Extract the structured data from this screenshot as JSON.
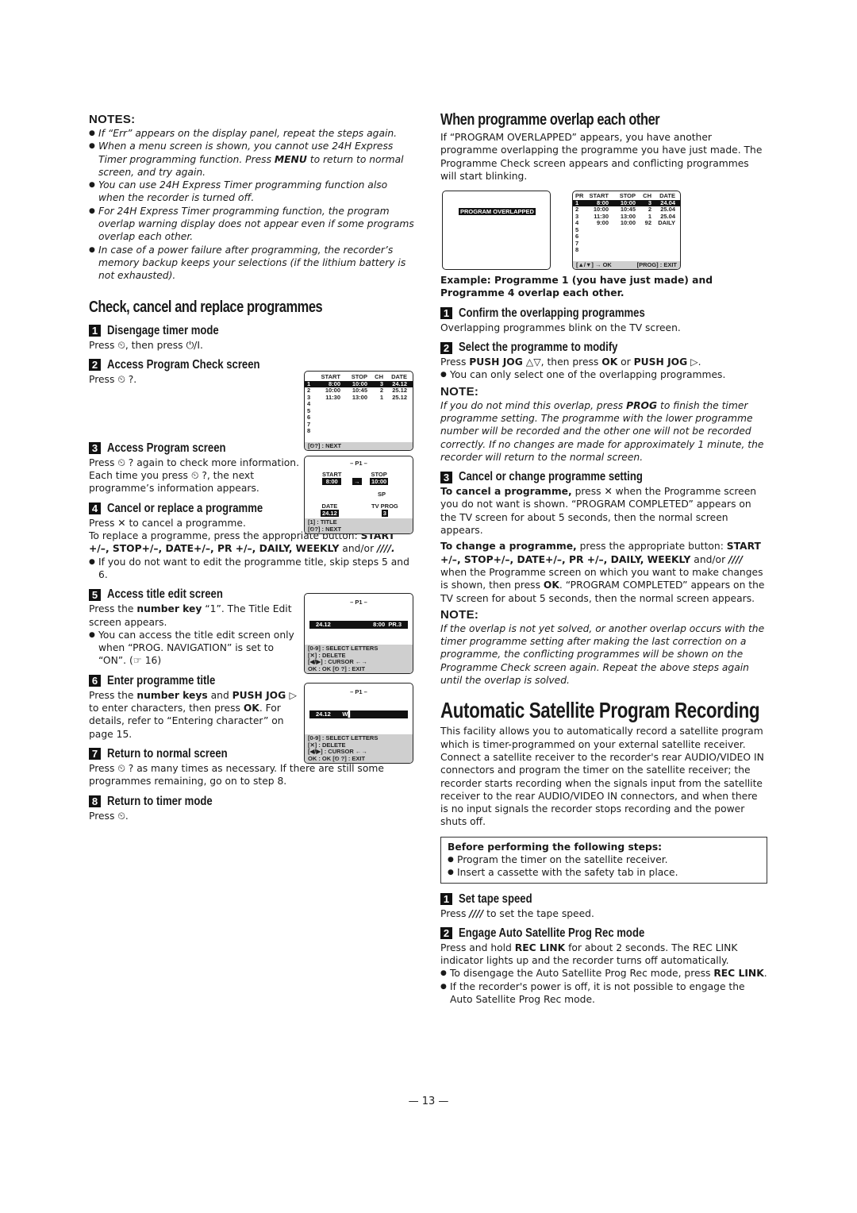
{
  "left": {
    "notes_title": "NOTES:",
    "notes": [
      "If “Err” appears on the display panel, repeat the steps again.",
      "When a menu screen is shown, you cannot use 24H Express Timer programming function. Press MENU to return to normal screen, and try again.",
      "You can use 24H Express Timer programming function also when the recorder is turned off.",
      "For 24H Express Timer programming function, the program overlap warning display does not appear even if some programs overlap each other.",
      "In case of a power failure after programming, the recorder’s memory backup keeps your selections (if the lithium battery is not exhausted)."
    ],
    "note2_pre": "When a menu screen is shown, you cannot use 24H Express Timer programming function. Press ",
    "note2_bold": "MENU",
    "note2_post": " to return to normal screen, and try again.",
    "section_title": "Check, cancel and replace programmes",
    "steps": [
      {
        "num": "1",
        "title": "Disengage timer mode",
        "text": "Press ⏲, then press ⏻/I."
      },
      {
        "num": "2",
        "title": "Access Program Check screen",
        "text": "Press ⏲ ?."
      },
      {
        "num": "3",
        "title": "Access Program screen",
        "text": "Press ⏲ ? again to check more information. Each time you press ⏲ ?, the next programme’s information appears."
      },
      {
        "num": "4",
        "title": "Cancel or replace a programme",
        "text1": "Press ✕ to cancel a programme.",
        "text2_pre": "To replace a programme, press the appropriate button: ",
        "text2_bold": "START +/–, STOP+/–, DATE+/–, PR +/–, DAILY, WEEKLY",
        "text2_mid": " and/or ",
        "text2_end": "////.",
        "bullet": "If you do not want to edit the programme title, skip steps 5 and 6."
      },
      {
        "num": "5",
        "title": "Access title edit screen",
        "text_pre": "Press the ",
        "text_bold": "number key",
        "text_post": " “1”. The Title Edit screen appears.",
        "bullet": "You can access the title edit screen only when “PROG. NAVIGATION” is set to “ON”. (☞ 16)"
      },
      {
        "num": "6",
        "title": "Enter programme title",
        "text_pre": "Press the ",
        "text_bold1": "number keys",
        "text_mid": " and ",
        "text_bold2": "PUSH JOG ▷",
        "text_post": " to enter characters, then press ",
        "text_bold3": "OK",
        "text_end": ". For details, refer to “Entering character” on page 15."
      },
      {
        "num": "7",
        "title": "Return to normal screen",
        "text": "Press ⏲ ? as many times as necessary. If there are still some programmes remaining, go on to step 8."
      },
      {
        "num": "8",
        "title": "Return to timer mode",
        "text": "Press ⏲."
      }
    ],
    "check_screen": {
      "headers": [
        "",
        "START",
        "STOP",
        "CH",
        "DATE"
      ],
      "rows": [
        [
          "1",
          "8:00",
          "10:00",
          "3",
          "24.12"
        ],
        [
          "2",
          "10:00",
          "10:45",
          "2",
          "25.12"
        ],
        [
          "3",
          "11:30",
          "13:00",
          "1",
          "25.12"
        ],
        [
          "4",
          "",
          "",
          "",
          ""
        ],
        [
          "5",
          "",
          "",
          "",
          ""
        ],
        [
          "6",
          "",
          "",
          "",
          ""
        ],
        [
          "7",
          "",
          "",
          "",
          ""
        ],
        [
          "8",
          "",
          "",
          "",
          ""
        ]
      ],
      "footer": "[⏲?] : NEXT"
    },
    "program_screen": {
      "title": "– P1 –",
      "start_label": "START",
      "start_value": "8:00",
      "stop_label": "STOP",
      "stop_value": "10:00",
      "arrow": "→",
      "speed": "SP",
      "date_label": "DATE",
      "date_value": "24.12",
      "tvprog_label": "TV PROG",
      "tvprog_value": "3",
      "footer1": "[1] : TITLE",
      "footer2": "[⏲?] : NEXT"
    },
    "title_edit_screen": {
      "title": "– P1 –",
      "date": "24.12",
      "time": "8:00",
      "pr": "PR.3",
      "footer": [
        "[0-9] : SELECT LETTERS",
        "[✕] : DELETE",
        "[◀/▶] : CURSOR ←→",
        "OK : OK        [⏲ ?] : EXIT"
      ]
    },
    "title_enter_screen": {
      "title": "– P1 –",
      "date": "24.12",
      "chars": "W▌",
      "footer": [
        "[0-9] : SELECT LETTERS",
        "[✕] : DELETE",
        "[◀/▶] : CURSOR ←→",
        "OK : OK        [⏲ ?] : EXIT"
      ]
    }
  },
  "right": {
    "overlap_title": "When programme overlap each other",
    "overlap_intro": "If “PROGRAM OVERLAPPED” appears, you have another programme overlapping the programme you have just made. The Programme Check screen appears and conflicting programmes will start blinking.",
    "overlap_screen_label": "PROGRAM OVERLAPPED",
    "overlap_check_screen": {
      "headers": [
        "PR",
        "START",
        "STOP",
        "CH",
        "DATE"
      ],
      "rows": [
        [
          "1",
          "8:00",
          "10:00",
          "3",
          "24.04"
        ],
        [
          "2",
          "10:00",
          "10:45",
          "2",
          "25.04"
        ],
        [
          "3",
          "11:30",
          "13:00",
          "1",
          "25.04"
        ],
        [
          "4",
          "9:00",
          "10:00",
          "92",
          "DAILY"
        ],
        [
          "5",
          "",
          "",
          "",
          ""
        ],
        [
          "6",
          "",
          "",
          "",
          ""
        ],
        [
          "7",
          "",
          "",
          "",
          ""
        ],
        [
          "8",
          "",
          "",
          "",
          ""
        ]
      ],
      "footer_left": "[▲/▼] → OK",
      "footer_right": "[PROG] : EXIT"
    },
    "example": "Example: Programme 1 (you have just made) and Programme 4 overlap each other.",
    "steps": [
      {
        "num": "1",
        "title": "Confirm the overlapping programmes",
        "text": "Overlapping programmes blink on the TV screen."
      },
      {
        "num": "2",
        "title": "Select the programme to modify",
        "text_pre": "Press ",
        "b1": "PUSH JOG",
        "t1": " △▽, then press ",
        "b2": "OK",
        "t2": " or ",
        "b3": "PUSH JOG",
        "t3": " ▷.",
        "bullet": "You can only select one of the overlapping programmes."
      },
      {
        "num": "3",
        "title": "Cancel or change programme setting"
      }
    ],
    "note1_title": "NOTE:",
    "note1_pre": "If you do not mind this overlap, press ",
    "note1_bold": "PROG",
    "note1_post": " to finish the timer programme setting. The programme with the lower programme number will be recorded and the other one will not be recorded correctly. If no changes are made for approximately 1 minute, the recorder will return to the normal screen.",
    "cancel_bold": "To cancel a programme,",
    "cancel_text": " press ✕ when the Programme screen you do not want is shown. “PROGRAM COMPLETED” appears on the TV screen for about 5 seconds, then the normal screen appears.",
    "change_bold": "To change a programme,",
    "change_text1": " press the appropriate button: ",
    "change_buttons": "START +/–, STOP+/–, DATE+/–, PR +/–, DAILY, WEEKLY",
    "change_text2": " and/or ",
    "change_speed": "////",
    "change_text3": " when the Programme screen on which you want to make changes is shown, then press ",
    "change_ok": "OK",
    "change_text4": ". “PROGRAM COMPLETED” appears on the TV screen for about 5 seconds, then the normal screen appears.",
    "note2_title": "NOTE:",
    "note2_text": "If the overlap is not yet solved, or another overlap occurs with the timer programme setting after making the last correction on a programme, the conflicting programmes will be shown on the Programme Check screen again. Repeat the above steps again until the overlap is solved.",
    "sat_title": "Automatic Satellite Program Recording",
    "sat_intro": "This facility allows you to automatically record a satellite program which is timer-programmed on your external satellite receiver. Connect a satellite receiver to the recorder's rear AUDIO/VIDEO IN connectors and program the timer on the satellite receiver; the recorder starts recording when the signals input from the satellite receiver to the rear AUDIO/VIDEO IN connectors, and when there is no input signals the recorder stops recording and the power shuts off.",
    "before_title": "Before performing the following steps:",
    "before_items": [
      "Program the timer on the satellite receiver.",
      "Insert a cassette with the safety tab in place."
    ],
    "sat_steps": [
      {
        "num": "1",
        "title": "Set tape speed",
        "text_pre": "Press ",
        "text_bold": "////",
        "text_post": " to set the tape speed."
      },
      {
        "num": "2",
        "title": "Engage Auto Satellite Prog Rec mode",
        "text_pre": "Press and hold ",
        "text_bold": "REC LINK",
        "text_post": " for about 2 seconds. The REC LINK indicator lights up and the recorder turns off automatically.",
        "bullet1_pre": "To disengage the Auto Satellite Prog Rec mode, press ",
        "bullet1_bold": "REC LINK",
        "bullet1_post": ".",
        "bullet2": "If the recorder's power is off, it is not possible to engage the Auto Satellite Prog Rec mode."
      }
    ]
  },
  "page_number": "— 13 —"
}
